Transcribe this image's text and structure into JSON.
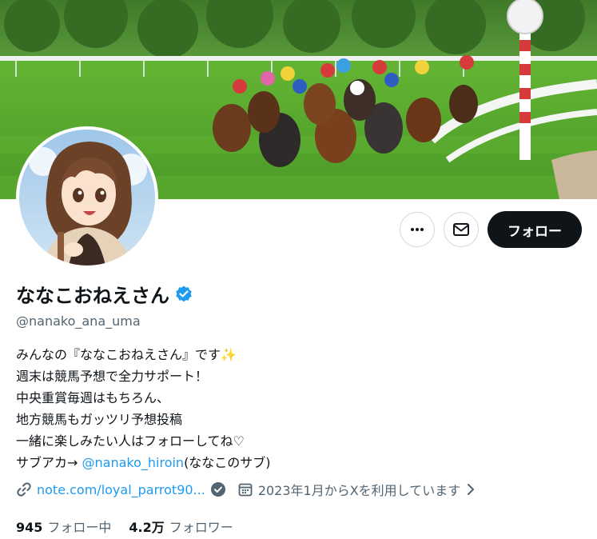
{
  "profile": {
    "display_name": "ななこおねえさん",
    "handle": "@nanako_ana_uma",
    "bio": {
      "line1": "みんなの『ななこおねえさん』です",
      "line1_emoji": "✨",
      "line2": "週末は競馬予想で全力サポート！",
      "line3": "中央重賞毎週はもちろん、",
      "line4": "地方競馬もガッツリ予想投稿",
      "line5": "一緒に楽しみたい人はフォローしてね♡",
      "line6_prefix": "サブアカ→ ",
      "line6_mention": "@nanako_hiroin",
      "line6_suffix": "(ななこのサブ)"
    },
    "website": "note.com/loyal_parrot90...",
    "joined": "2023年1月からXを利用しています",
    "following_count": "945",
    "following_label": "フォロー中",
    "followers_count": "4.2万",
    "followers_label": "フォロワー"
  },
  "actions": {
    "more_icon": "more-icon",
    "message_icon": "mail-icon",
    "follow_label": "フォロー"
  },
  "colors": {
    "accent": "#1d9bf0",
    "text": "#0f1419",
    "muted": "#536471",
    "follow_button_bg": "#0f1419"
  }
}
